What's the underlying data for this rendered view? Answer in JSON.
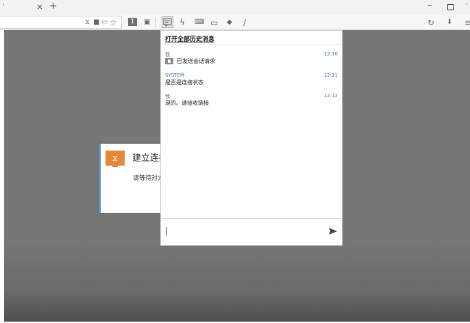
{
  "browser": {
    "tab_close_icon": "close-icon",
    "tab_new_icon": "plus-icon",
    "badge_number": "1",
    "window_controls": [
      "minimize",
      "maximize",
      "close"
    ]
  },
  "dialog": {
    "title": "建立连接",
    "message": "请等待对方",
    "icon": "hourglass-icon",
    "accent_color": "#e38a3a"
  },
  "chat": {
    "history_link": "打开全部历史消息",
    "messages": [
      {
        "sender": "我",
        "time": "12:10",
        "text": "已发送会话请求",
        "has_icon": true
      },
      {
        "sender": "SYSTEM",
        "time": "12:11",
        "text": "是否是连接状态"
      },
      {
        "sender": "我",
        "time": "12:12",
        "text": "是的。请接收链接"
      }
    ],
    "input_value": "",
    "send_icon": "send-icon",
    "sender_color": "#3a6ab8"
  },
  "colors": {
    "page_background": "#777777",
    "dialog_border": "#5b8fd0"
  }
}
